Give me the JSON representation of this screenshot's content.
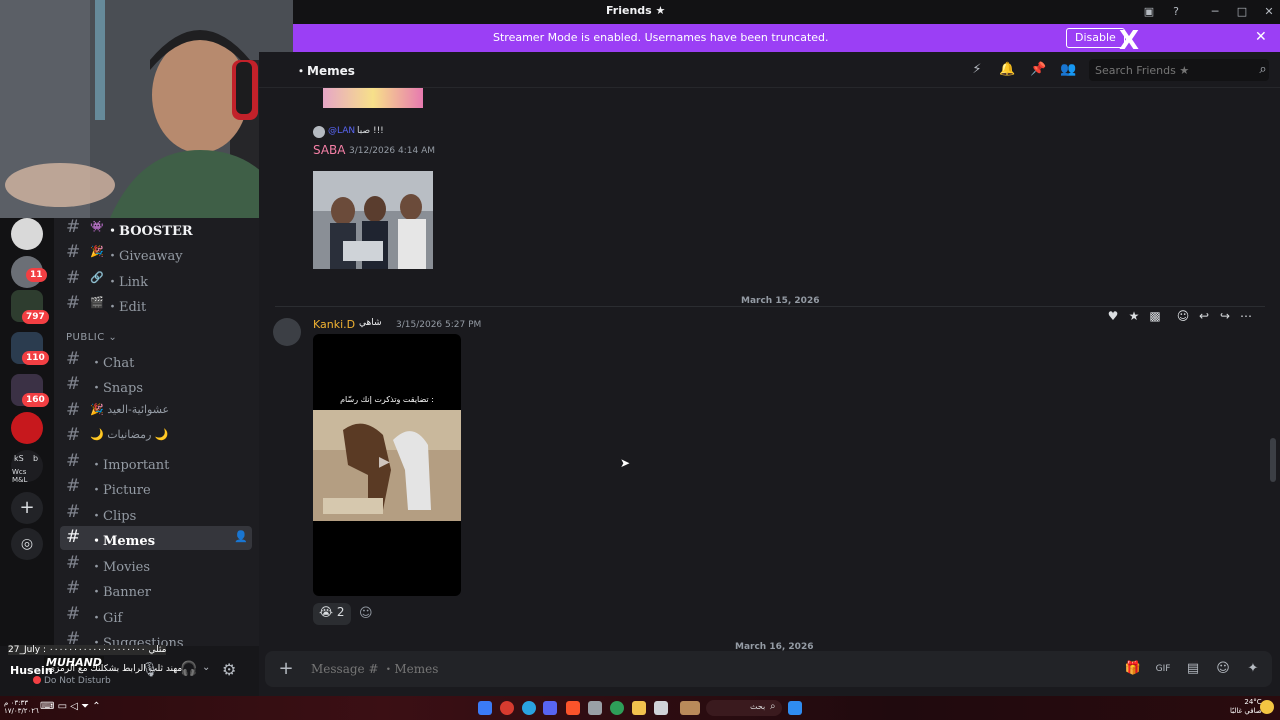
{
  "window": {
    "title": "Friends ★",
    "icons": [
      "inbox-icon",
      "help-icon",
      "minimize-icon",
      "maximize-icon",
      "close-icon"
    ]
  },
  "banner": {
    "message": "Streamer Mode is enabled. Usernames have been truncated.",
    "disable_label": "Disable",
    "close_glyph": "✕",
    "x_logo": "X",
    "color": "#9b3ff5"
  },
  "servers": {
    "badges": [
      "11",
      "797",
      "110",
      "160"
    ],
    "folder_text_1": "kS",
    "folder_text_2": "b",
    "folder_text_3": "Wcs M&L"
  },
  "channels": {
    "category": "PUBLIC",
    "top": [
      {
        "emoji": "👾",
        "label": "・BOOSTER"
      },
      {
        "emoji": "🎉",
        "label": "・Giveaway"
      },
      {
        "emoji": "🔗",
        "label": "・Link"
      },
      {
        "emoji": "🎬",
        "label": "・Edit"
      }
    ],
    "items": [
      {
        "label": "・Chat"
      },
      {
        "label": "・Snaps"
      },
      {
        "label": "🎉 عشوائية-العيد"
      },
      {
        "label": "🌙 رمضانيات 🌙"
      },
      {
        "label": "・Important"
      },
      {
        "label": "・Picture"
      },
      {
        "label": "・Clips"
      },
      {
        "label": "・Memes"
      },
      {
        "label": "・Movies"
      },
      {
        "label": "・Banner"
      },
      {
        "label": "・Gif"
      },
      {
        "label": "・Suggestions"
      }
    ]
  },
  "userbar": {
    "overlay_line1": "27_July : مثلي ٠٠٠٠٠٠٠٠٠٠٠٠٠٠٠٠٠٠٠٠",
    "overlay_name": "MUHAND",
    "username": "Husein",
    "overlay_line2": "مهند ثلث الرابط بشكلنك مع الرمزي",
    "status": "Do Not Disturb"
  },
  "chat": {
    "channel": "・Memes",
    "search_placeholder": "Search Friends ★",
    "reply_user": "@LAN",
    "reply_text": "صبا !!!",
    "msg1_author": "SABA",
    "msg1_time": "3/12/2026 4:14 AM",
    "date_divider": "March 15, 2026",
    "msg2_author": "Kanki.D",
    "msg2_tag": "شاهي",
    "msg2_time": "3/15/2026 5:27 PM",
    "video_caption": "تضايقت وتذكرت إنك رسّام :",
    "reaction_emoji": "😭",
    "reaction_count": "2",
    "next_divider": "March 16, 2026",
    "composer_placeholder": "Message # ・Memes"
  },
  "taskbar": {
    "weather_temp": "24°C",
    "weather_desc": "صافي غالبًا",
    "time": "٠٣:٣٣ م",
    "date": "١٧/٠٣/٢٠٢٦",
    "search_label": "بحث"
  }
}
